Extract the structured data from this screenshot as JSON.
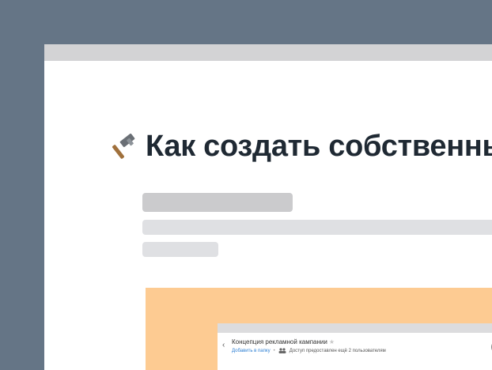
{
  "page": {
    "title": "Как создать собственный",
    "title_icon": "hammer-icon"
  },
  "preview": {
    "doc_title": "Концепция рекламной кампании",
    "star_icon": "★",
    "add_to_folder": "Добавить в папку",
    "separator": "•",
    "access_text": "Доступ предоставлен ещё 2 пользователям"
  },
  "colors": {
    "background": "#657586",
    "title_text": "#1f2933",
    "preview_bg": "#fdcb92",
    "link": "#2d7fd3"
  }
}
